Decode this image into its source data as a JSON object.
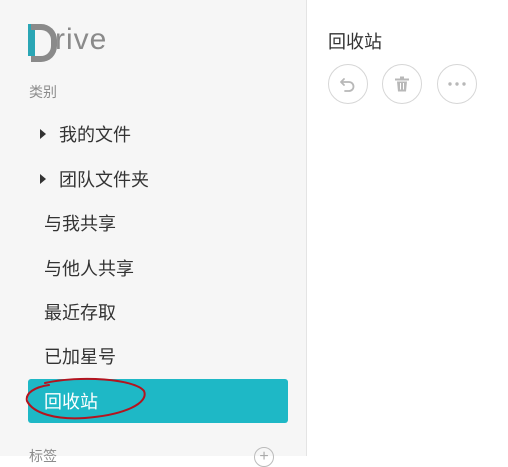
{
  "app": {
    "logo_text": "rive"
  },
  "sidebar": {
    "category_label": "类别",
    "items": [
      {
        "label": "我的文件"
      },
      {
        "label": "团队文件夹"
      },
      {
        "label": "与我共享"
      },
      {
        "label": "与他人共享"
      },
      {
        "label": "最近存取"
      },
      {
        "label": "已加星号"
      },
      {
        "label": "回收站"
      }
    ],
    "tags_label": "标签"
  },
  "main": {
    "title": "回收站",
    "toolbar": [
      {
        "icon": "restore-icon"
      },
      {
        "icon": "trash-icon"
      },
      {
        "icon": "more-icon"
      }
    ]
  },
  "colors": {
    "accent": "#1eb8c6",
    "annotation": "#b3141f",
    "logo_teal": "#2aa6b5"
  }
}
